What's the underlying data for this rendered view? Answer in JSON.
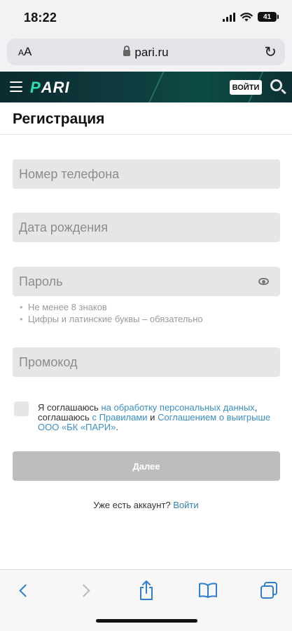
{
  "status_bar": {
    "time": "18:22",
    "battery": "41"
  },
  "address_bar": {
    "aa_label": "AA",
    "url": "pari.ru"
  },
  "site_header": {
    "logo": "PARI",
    "login_button": "ВОЙТИ"
  },
  "page": {
    "title": "Регистрация"
  },
  "form": {
    "phone_placeholder": "Номер телефона",
    "birthdate_placeholder": "Дата рождения",
    "password_placeholder": "Пароль",
    "password_hints": [
      "Не менее 8 знаков",
      "Цифры и латинские буквы – обязательно"
    ],
    "promo_placeholder": "Промокод",
    "agreement": {
      "part1": "Я соглашаюсь ",
      "link1": "на обработку персональных данных",
      "part2": ", соглашаюсь ",
      "link2": "с Правилами",
      "part3": " и ",
      "link3": "Соглашением о выигрыше ООО «БК «ПАРИ»",
      "part4": "."
    },
    "next_button": "Далее",
    "have_account_text": "Уже есть аккаунт? ",
    "login_link": "Войти"
  },
  "colors": {
    "link": "#3a8fc8",
    "header_bg": "#0f3a3d",
    "logo_accent": "#29e3b4",
    "button_disabled": "#bdbdbd",
    "field_bg": "#e6e6e6"
  },
  "toolbar_icons": [
    "back-icon",
    "forward-icon",
    "share-icon",
    "bookmarks-icon",
    "tabs-icon"
  ]
}
